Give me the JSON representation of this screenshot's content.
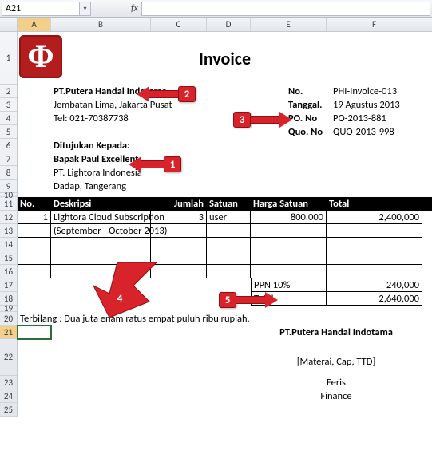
{
  "toolbar": {
    "cell_ref": "A21",
    "fx_label": "fx",
    "formula": ""
  },
  "columns": [
    "A",
    "B",
    "C",
    "D",
    "E",
    "F"
  ],
  "rows_visible": [
    1,
    2,
    3,
    4,
    5,
    6,
    7,
    8,
    9,
    10,
    11,
    12,
    13,
    14,
    15,
    16,
    17,
    18,
    19,
    20,
    21,
    22,
    23,
    24,
    25
  ],
  "doc": {
    "title": "Invoice",
    "company": {
      "name": "PT.Putera Handal Indotama",
      "addr": "Jembatan Lima, Jakarta Pusat",
      "tel": "Tel: 021-70387738"
    },
    "meta_labels": {
      "no": "No.",
      "tanggal": "Tanggal.",
      "po": "PO. No",
      "quo": "Quo. No"
    },
    "meta": {
      "no": "PHI-Invoice-013",
      "tanggal": "19 Agustus 2013",
      "po": "PO-2013-881",
      "quo": "QUO-2013-998"
    },
    "to_label": "Ditujukan Kepada:",
    "to": {
      "person": "Bapak Paul Excellent",
      "company": "PT. Lightora Indonesia",
      "addr": "Dadap, Tangerang"
    },
    "table": {
      "headers": {
        "no": "No.",
        "desc": "Deskripsi",
        "qty": "Jumlah",
        "unit": "Satuan",
        "price": "Harga Satuan",
        "total": "Total"
      },
      "rows": [
        {
          "no": "1",
          "desc": "Lightora Cloud Subscription",
          "qty": "3",
          "unit": "user",
          "price": "800,000",
          "total": "2,400,000"
        },
        {
          "no": "",
          "desc": "(September - October 2013)",
          "qty": "",
          "unit": "",
          "price": "",
          "total": ""
        },
        {
          "no": "",
          "desc": "",
          "qty": "",
          "unit": "",
          "price": "",
          "total": ""
        },
        {
          "no": "",
          "desc": "",
          "qty": "",
          "unit": "",
          "price": "",
          "total": ""
        },
        {
          "no": "",
          "desc": "",
          "qty": "",
          "unit": "",
          "price": "",
          "total": ""
        }
      ],
      "ppn_label": "PPN 10%",
      "ppn": "240,000",
      "total_label": "Total",
      "grand_total": "2,640,000"
    },
    "terbilang": "Terbilang : Dua juta enam ratus empat puluh ribu rupiah.",
    "sign_company": "PT.Putera Handal Indotama",
    "sign_note": "[Materai, Cap, TTD]",
    "sign_name": "Feris",
    "sign_role": "Finance"
  },
  "callouts": {
    "1": "1",
    "2": "2",
    "3": "3",
    "4": "4",
    "5": "5"
  }
}
